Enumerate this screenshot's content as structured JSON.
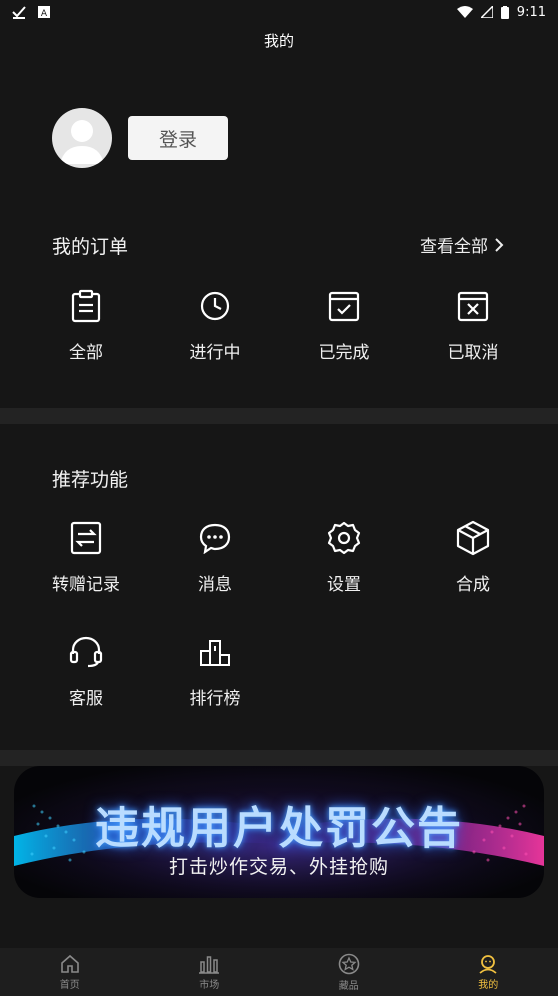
{
  "status_bar": {
    "time": "9:11"
  },
  "title": "我的",
  "profile": {
    "login_label": "登录"
  },
  "orders": {
    "title": "我的订单",
    "view_all": "查看全部",
    "items": [
      {
        "label": "全部",
        "icon": "clipboard-icon"
      },
      {
        "label": "进行中",
        "icon": "clock-icon"
      },
      {
        "label": "已完成",
        "icon": "calendar-check-icon"
      },
      {
        "label": "已取消",
        "icon": "calendar-x-icon"
      }
    ]
  },
  "features": {
    "title": "推荐功能",
    "items": [
      {
        "label": "转赠记录",
        "icon": "transfer-icon"
      },
      {
        "label": "消息",
        "icon": "chat-icon"
      },
      {
        "label": "设置",
        "icon": "gear-icon"
      },
      {
        "label": "合成",
        "icon": "cube-icon"
      },
      {
        "label": "客服",
        "icon": "headset-icon"
      },
      {
        "label": "排行榜",
        "icon": "ranking-icon"
      }
    ]
  },
  "banner": {
    "title": "违规用户处罚公告",
    "subtitle": "打击炒作交易、外挂抢购"
  },
  "tabs": [
    {
      "label": "首页",
      "icon": "home-icon",
      "active": false
    },
    {
      "label": "市场",
      "icon": "market-icon",
      "active": false
    },
    {
      "label": "藏品",
      "icon": "star-icon",
      "active": false
    },
    {
      "label": "我的",
      "icon": "profile-icon",
      "active": true
    }
  ],
  "colors": {
    "background": "#161616",
    "accent": "#f0c040",
    "divider": "#232323"
  }
}
